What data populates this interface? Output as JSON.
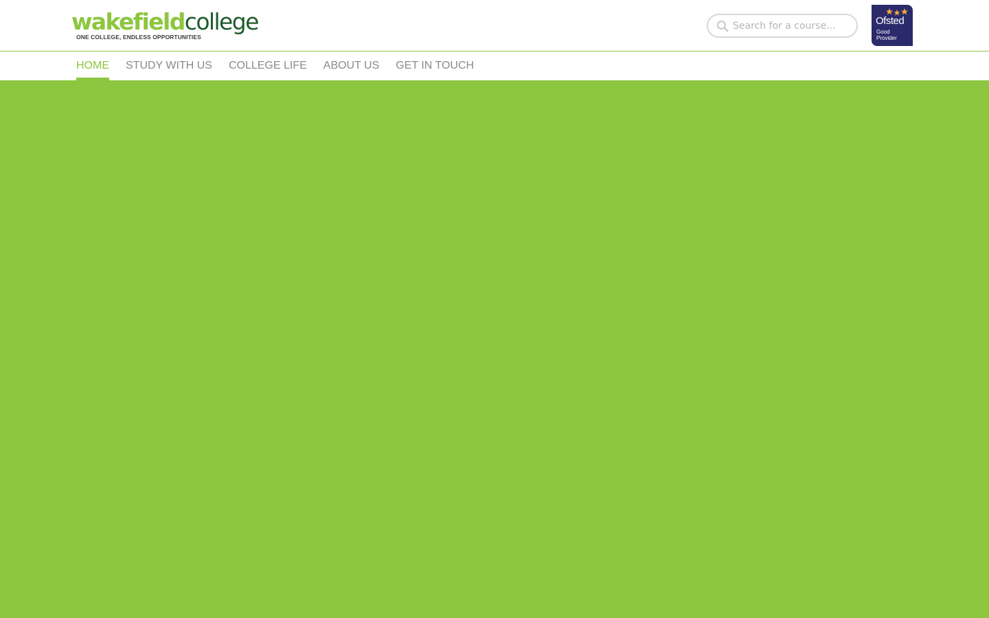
{
  "brand": {
    "logo_part1": "wakefield",
    "logo_part2": "college",
    "tagline": "ONE COLLEGE, ENDLESS OPPORTUNITIES",
    "primary_color": "#8dc63f",
    "dark_green": "#1e5b2a"
  },
  "search": {
    "placeholder": "Search for a course...",
    "value": ""
  },
  "ofsted": {
    "name": "Ofsted",
    "grade_line1": "Good",
    "grade_line2": "Provider",
    "color": "#2b2a6b"
  },
  "nav": {
    "items": [
      {
        "label": "HOME",
        "active": true
      },
      {
        "label": "STUDY WITH US",
        "active": false
      },
      {
        "label": "COLLEGE LIFE",
        "active": false
      },
      {
        "label": "ABOUT US",
        "active": false
      },
      {
        "label": "GET IN TOUCH",
        "active": false
      }
    ]
  },
  "hero": {
    "background": "#8dc63f"
  }
}
